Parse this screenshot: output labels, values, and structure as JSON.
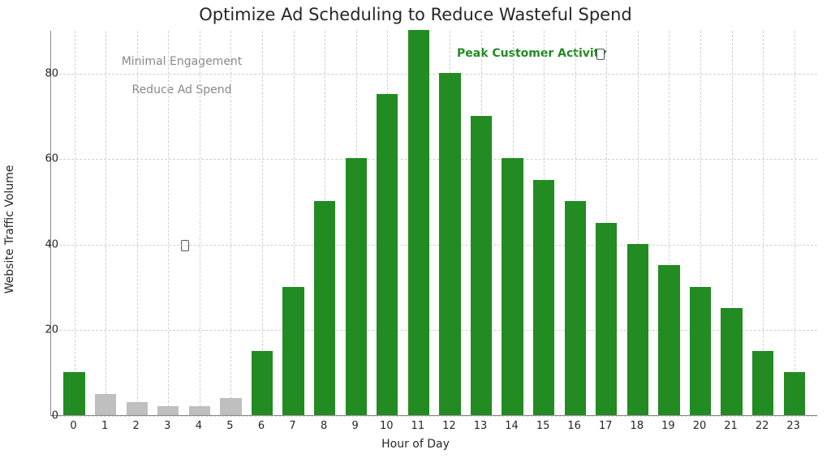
{
  "chart_data": {
    "type": "bar",
    "title": "Optimize Ad Scheduling to Reduce Wasteful Spend",
    "xlabel": "Hour of Day",
    "ylabel": "Website Traffic Volume",
    "ylim": [
      0,
      90
    ],
    "yticks": [
      0,
      20,
      40,
      60,
      80
    ],
    "categories": [
      0,
      1,
      2,
      3,
      4,
      5,
      6,
      7,
      8,
      9,
      10,
      11,
      12,
      13,
      14,
      15,
      16,
      17,
      18,
      19,
      20,
      21,
      22,
      23
    ],
    "values": [
      10,
      5,
      3,
      2,
      2,
      4,
      15,
      30,
      50,
      60,
      75,
      90,
      80,
      70,
      60,
      55,
      50,
      45,
      40,
      35,
      30,
      25,
      15,
      10
    ],
    "series_class": [
      "hi",
      "lo",
      "lo",
      "lo",
      "lo",
      "lo",
      "hi",
      "hi",
      "hi",
      "hi",
      "hi",
      "hi",
      "hi",
      "hi",
      "hi",
      "hi",
      "hi",
      "hi",
      "hi",
      "hi",
      "hi",
      "hi",
      "hi",
      "hi"
    ],
    "palette": {
      "hi": "#228B22",
      "lo": "#BFBFBF"
    },
    "annotations": {
      "low": {
        "line1": "Minimal Engagement",
        "line2": "Reduce Ad Spend"
      },
      "peak": "Peak Customer Activity"
    }
  }
}
